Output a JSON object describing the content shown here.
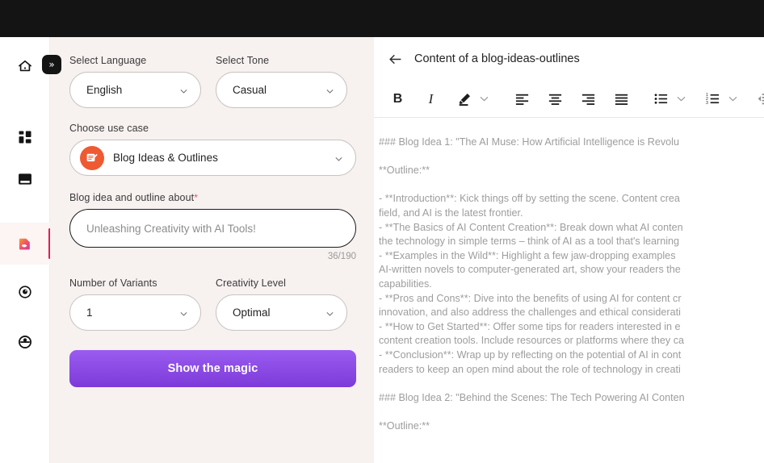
{
  "topbar": {
    "label": ""
  },
  "sidebar": {
    "items": [
      {
        "name": "home",
        "icon": "home-icon",
        "active": false
      },
      {
        "name": "dashboard",
        "icon": "grid-dashboard-icon",
        "active": false
      },
      {
        "name": "images",
        "icon": "image-card-icon",
        "active": false
      },
      {
        "name": "writer",
        "icon": "ai-writer-icon",
        "active": true
      },
      {
        "name": "vision",
        "icon": "eye-icon",
        "active": false
      },
      {
        "name": "account",
        "icon": "user-account-icon",
        "active": false
      }
    ],
    "collapse_label": "»"
  },
  "form": {
    "language": {
      "label": "Select Language",
      "value": "English"
    },
    "tone": {
      "label": "Select Tone",
      "value": "Casual"
    },
    "use_case": {
      "label": "Choose use case",
      "value": "Blog Ideas & Outlines",
      "icon": "document-pencil-icon"
    },
    "prompt": {
      "label": "Blog idea and outline about",
      "required_marker": "*",
      "placeholder": "Unleashing Creativity with AI Tools!",
      "value": "",
      "counter": "36/190"
    },
    "variants": {
      "label": "Number of Variants",
      "value": "1"
    },
    "creativity": {
      "label": "Creativity Level",
      "value": "Optimal"
    },
    "submit_label": "Show the magic"
  },
  "editor": {
    "back_icon": "arrow-left-icon",
    "title": "Content of a blog-ideas-outlines",
    "toolbar": [
      {
        "name": "bold-button",
        "glyph": "B"
      },
      {
        "name": "italic-button",
        "glyph": "I"
      },
      {
        "name": "highlight-color-button",
        "glyph": "pen-icon"
      },
      {
        "name": "highlight-dropdown",
        "glyph": "chevron-down-icon"
      },
      {
        "name": "align-left-button",
        "glyph": "align-left-icon"
      },
      {
        "name": "align-center-button",
        "glyph": "align-center-icon"
      },
      {
        "name": "align-right-button",
        "glyph": "align-right-icon"
      },
      {
        "name": "align-justify-button",
        "glyph": "align-justify-icon"
      },
      {
        "name": "bullet-list-button",
        "glyph": "bullet-list-icon"
      },
      {
        "name": "bullet-list-dropdown",
        "glyph": "chevron-down-icon"
      },
      {
        "name": "numbered-list-button",
        "glyph": "numbered-list-icon"
      },
      {
        "name": "numbered-list-dropdown",
        "glyph": "chevron-down-icon"
      },
      {
        "name": "outdent-button",
        "glyph": "outdent-icon"
      },
      {
        "name": "indent-button",
        "glyph": "indent-icon"
      }
    ],
    "content_lines": [
      "### Blog Idea 1: \"The AI Muse: How Artificial Intelligence is Revolu",
      "",
      "**Outline:**",
      "",
      "- **Introduction**: Kick things off by setting the scene. Content crea",
      "field, and AI is the latest frontier.",
      "- **The Basics of AI Content Creation**: Break down what AI conten",
      "the technology in simple terms – think of AI as a tool that's learning",
      "- **Examples in the Wild**: Highlight a few jaw-dropping examples",
      "AI-written novels to computer-generated art, show your readers the",
      "capabilities.",
      "- **Pros and Cons**: Dive into the benefits of using AI for content cr",
      "innovation, and also address the challenges and ethical considerati",
      "- **How to Get Started**: Offer some tips for readers interested in e",
      "content creation tools. Include resources or platforms where they ca",
      "- **Conclusion**: Wrap up by reflecting on the potential of AI in cont",
      "readers to keep an open mind about the role of technology in creati",
      "",
      "### Blog Idea 2: \"Behind the Scenes: The Tech Powering AI Conten",
      "",
      "**Outline:**"
    ]
  },
  "colors": {
    "topbar": "#141414",
    "form_bg": "#f7f1f0",
    "accent_purple": "#8a4ae6",
    "active_rail": "#e01e5a",
    "use_case_orange": "#ee5a32"
  }
}
